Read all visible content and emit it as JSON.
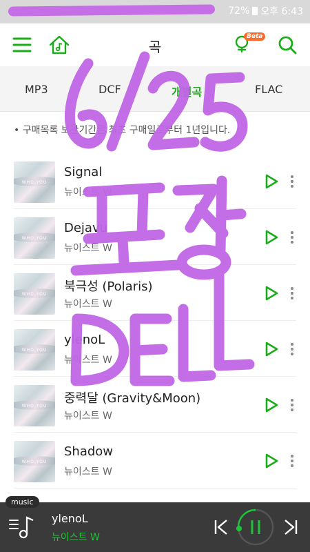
{
  "status_bar": {
    "battery": "72%",
    "time": "오후 6:43"
  },
  "header": {
    "title": "곡",
    "beta_badge": "Beta",
    "icons": [
      "menu-icon",
      "home-music-icon",
      "mic-icon",
      "search-icon"
    ]
  },
  "tabs": [
    {
      "label": "MP3",
      "active": false
    },
    {
      "label": "DCF",
      "active": false
    },
    {
      "label": "개별곡",
      "active": true
    },
    {
      "label": "FLAC",
      "active": false
    }
  ],
  "notice": "• 구매목록 보관기간은 최초 구매일로부터 1년입니다.",
  "songs": [
    {
      "title": "Signal",
      "artist": "뉴이스트 W"
    },
    {
      "title": "Dejavu",
      "artist": "뉴이스트 W"
    },
    {
      "title": "북극성 (Polaris)",
      "artist": "뉴이스트 W"
    },
    {
      "title": "ylenoL",
      "artist": "뉴이스트 W"
    },
    {
      "title": "중력달 (Gravity&Moon)",
      "artist": "뉴이스트 W"
    },
    {
      "title": "Shadow",
      "artist": "뉴이스트 W"
    }
  ],
  "album_art_text": "WHO,YOU",
  "player": {
    "tag": "music",
    "now_playing_title": "ylenoL",
    "now_playing_artist": "뉴이스트 W"
  },
  "overlay_text": [
    "6/25",
    "포장",
    "DELL"
  ],
  "colors": {
    "accent": "#1aad19",
    "overlay": "#c066e6",
    "player_bg": "#3a3a3a"
  }
}
